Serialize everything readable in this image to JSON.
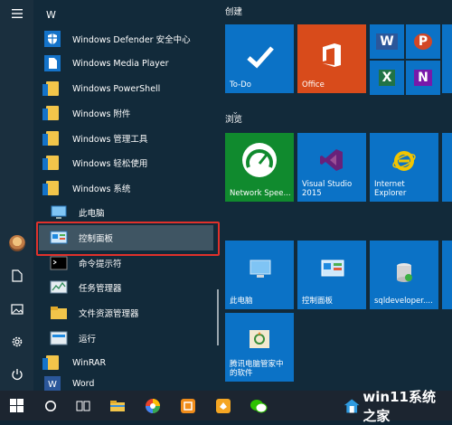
{
  "rail": {
    "icons": [
      "hamburger-menu-icon",
      "user-avatar",
      "document-icon",
      "pictures-icon",
      "settings-gear-icon",
      "power-icon"
    ]
  },
  "list": {
    "letter": "W",
    "items": [
      {
        "label": "Windows Defender 安全中心",
        "icon": "shield-icon",
        "chevron": ""
      },
      {
        "label": "Windows Media Player",
        "icon": "document-icon",
        "chevron": ""
      },
      {
        "label": "Windows PowerShell",
        "icon": "folder-icon",
        "chevron": "⌄"
      },
      {
        "label": "Windows 附件",
        "icon": "folder-icon",
        "chevron": "⌄"
      },
      {
        "label": "Windows 管理工具",
        "icon": "folder-icon",
        "chevron": "⌄"
      },
      {
        "label": "Windows 轻松使用",
        "icon": "folder-icon",
        "chevron": "⌄"
      },
      {
        "label": "Windows 系统",
        "icon": "folder-icon",
        "chevron": "⌃"
      },
      {
        "label": "此电脑",
        "icon": "computer-icon"
      },
      {
        "label": "控制面板",
        "icon": "control-panel-icon"
      },
      {
        "label": "命令提示符",
        "icon": "command-prompt-icon"
      },
      {
        "label": "任务管理器",
        "icon": "task-manager-icon"
      },
      {
        "label": "文件资源管理器",
        "icon": "file-explorer-icon"
      },
      {
        "label": "运行",
        "icon": "run-icon"
      },
      {
        "label": "WinRAR",
        "icon": "folder-icon",
        "chevron": "⌄"
      },
      {
        "label": "Word",
        "icon": "word-icon"
      }
    ]
  },
  "groups": {
    "create": "创建",
    "browse": "浏览"
  },
  "tiles": {
    "todo": "To-Do",
    "office": "Office",
    "network": "Network Spee...",
    "vs": "Visual Studio\n2015",
    "ie": "Internet\nExplorer",
    "pc": "此电脑",
    "cp": "控制面板",
    "sql": "sqldeveloper....",
    "softmgr": "腾讯电脑管家中\n的软件"
  },
  "mini": {
    "word": "W",
    "ppt": "P",
    "excel": "X",
    "onenote": "N"
  },
  "colors": {
    "tile_blue": "#0b72c6",
    "office_orange": "#d84b1b",
    "highlight_red": "#e0312b",
    "vs_purple": "#68217a"
  },
  "taskbar": {
    "icons": [
      "windows-start-icon",
      "search-circle-icon",
      "task-view-icon",
      "file-explorer-icon",
      "color-wheel-app-icon",
      "orange-app-icon",
      "orange-square-app-icon",
      "wechat-icon"
    ]
  },
  "watermark": {
    "text": "win11系统之家"
  }
}
